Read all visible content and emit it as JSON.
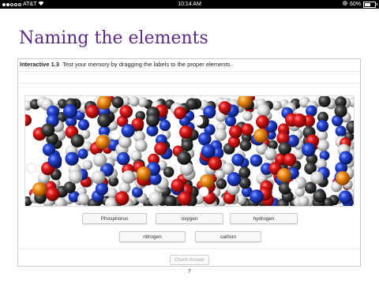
{
  "status_bar": {
    "carrier": "AT&T",
    "time": "10:14 AM",
    "battery": "60%"
  },
  "page_title": "Naming the elements",
  "interactive": {
    "label": "Interactive 1.3",
    "instruction": "Test your memory by dragging the labels to the proper elements."
  },
  "labels": {
    "phosphorus": "Phosphorus",
    "oxygen": "oxygen",
    "hydrogen": "hydrogen",
    "nitrogen": "nitrogen",
    "carbon": "carbon"
  },
  "check_button": "Check Answer",
  "page_number": "7",
  "colors": {
    "title": "#5b2a86",
    "oxygen_atom": "#d0111b",
    "nitrogen_atom": "#1f3fd0",
    "carbon_atom": "#3a3a3a",
    "hydrogen_atom": "#e8e8e8",
    "phosphorus_atom": "#f08a12"
  }
}
